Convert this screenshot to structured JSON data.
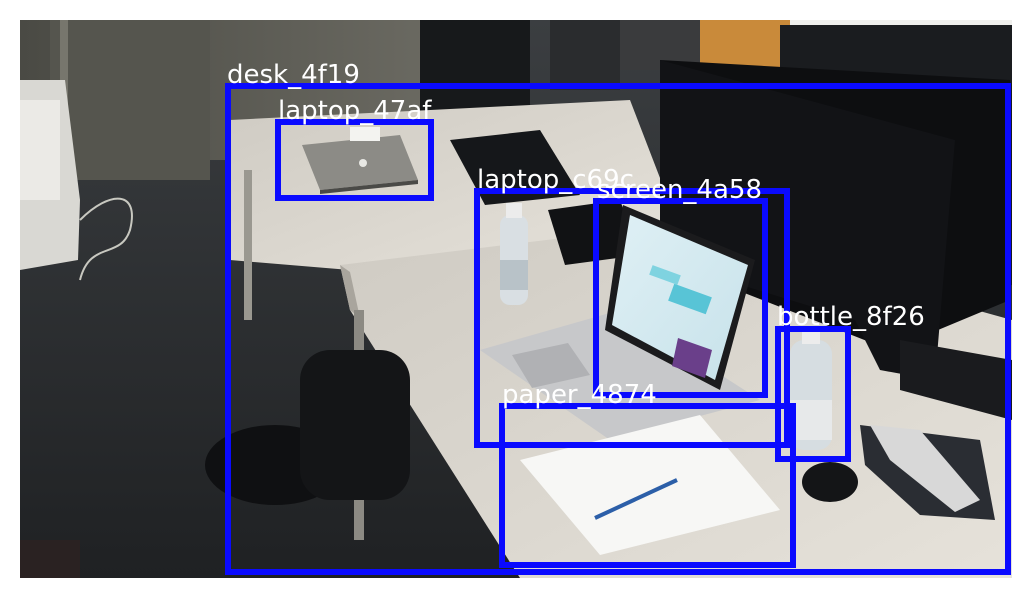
{
  "image": {
    "description_free": true,
    "box_color": "#0a0aff",
    "label_color": "#ffffff"
  },
  "annotations": [
    {
      "id": "desk",
      "label": "desk_4f19"
    },
    {
      "id": "laptop1",
      "label": "laptop_47af"
    },
    {
      "id": "laptop2",
      "label": "laptop_c69c"
    },
    {
      "id": "screen",
      "label": "screen_4a58"
    },
    {
      "id": "bottle",
      "label": "bottle_8f26"
    },
    {
      "id": "paper",
      "label": "paper_4874"
    }
  ]
}
